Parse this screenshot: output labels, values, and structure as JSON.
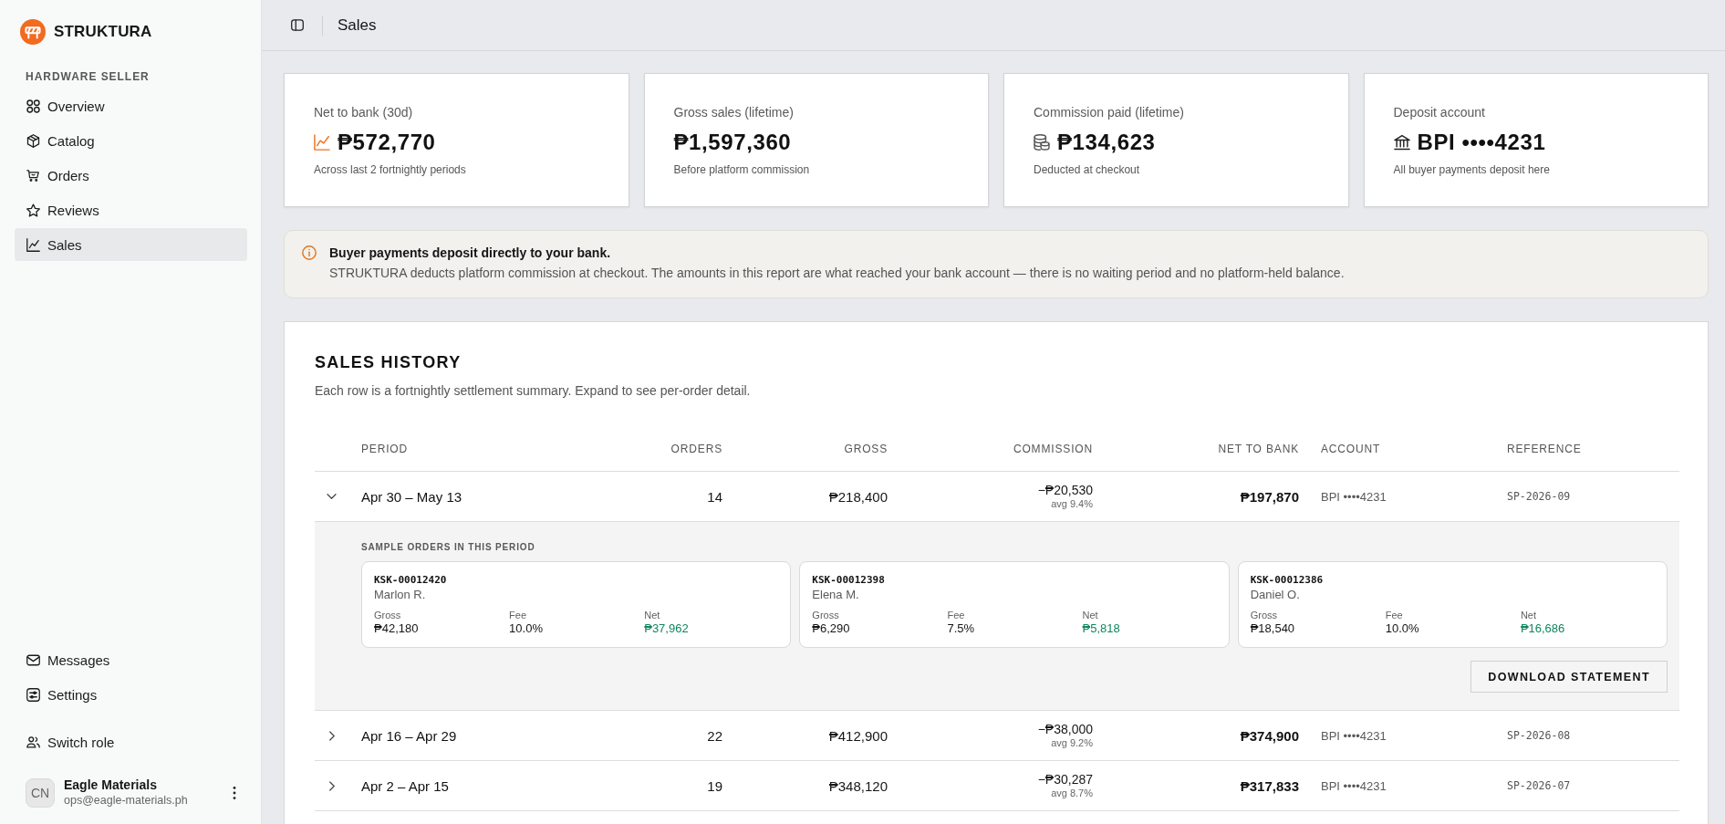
{
  "sidebar": {
    "brand": "STRUKTURA",
    "section": "HARDWARE SELLER",
    "nav": [
      {
        "label": "Overview",
        "selected": false
      },
      {
        "label": "Catalog",
        "selected": false
      },
      {
        "label": "Orders",
        "selected": false
      },
      {
        "label": "Reviews",
        "selected": false
      },
      {
        "label": "Sales",
        "selected": true
      }
    ],
    "bottom_nav": [
      {
        "label": "Messages",
        "selected": false
      },
      {
        "label": "Settings",
        "selected": false
      }
    ],
    "switch_role": "Switch role",
    "user": {
      "initials": "CN",
      "name": "Eagle Materials",
      "email": "ops@eagle-materials.ph"
    }
  },
  "topbar": {
    "title": "Sales"
  },
  "stats": [
    {
      "label": "Net to bank (30d)",
      "value": "₱572,770",
      "note": "Across last 2 fortnightly periods"
    },
    {
      "label": "Gross sales (lifetime)",
      "value": "₱1,597,360",
      "note": "Before platform commission"
    },
    {
      "label": "Commission paid (lifetime)",
      "value": "₱134,623",
      "note": "Deducted at checkout"
    },
    {
      "label": "Deposit account",
      "value": "BPI ••••4231",
      "note": "All buyer payments deposit here"
    }
  ],
  "notice": {
    "title": "Buyer payments deposit directly to your bank.",
    "text": "STRUKTURA deducts platform commission at checkout. The amounts in this report are what reached your bank account — there is no waiting period and no platform-held balance."
  },
  "sales_history": {
    "title": "SALES HISTORY",
    "subtitle": "Each row is a fortnightly settlement summary. Expand to see per-order detail.",
    "columns": [
      "PERIOD",
      "ORDERS",
      "GROSS",
      "COMMISSION",
      "NET TO BANK",
      "ACCOUNT",
      "REFERENCE"
    ],
    "rows": [
      {
        "expanded": true,
        "period": "Apr 30 – May 13",
        "orders": "14",
        "gross": "₱218,400",
        "commission": "−₱20,530",
        "commission_rate": "avg 9.4%",
        "net": "₱197,870",
        "account": "BPI ••••4231",
        "reference": "SP-2026-09",
        "detail": {
          "heading": "SAMPLE ORDERS IN THIS PERIOD",
          "orders": [
            {
              "id": "KSK-00012420",
              "buyer": "Marlon R.",
              "fields": [
                {
                  "label": "Gross",
                  "value": "₱42,180"
                },
                {
                  "label": "Fee",
                  "value": "10.0%"
                },
                {
                  "label": "Net",
                  "value": "₱37,962"
                }
              ]
            },
            {
              "id": "KSK-00012398",
              "buyer": "Elena M.",
              "fields": [
                {
                  "label": "Gross",
                  "value": "₱6,290"
                },
                {
                  "label": "Fee",
                  "value": "7.5%"
                },
                {
                  "label": "Net",
                  "value": "₱5,818"
                }
              ]
            },
            {
              "id": "KSK-00012386",
              "buyer": "Daniel O.",
              "fields": [
                {
                  "label": "Gross",
                  "value": "₱18,540"
                },
                {
                  "label": "Fee",
                  "value": "10.0%"
                },
                {
                  "label": "Net",
                  "value": "₱16,686"
                }
              ]
            }
          ],
          "button": "DOWNLOAD STATEMENT"
        }
      },
      {
        "expanded": false,
        "period": "Apr 16 – Apr 29",
        "orders": "22",
        "gross": "₱412,900",
        "commission": "−₱38,000",
        "commission_rate": "avg 9.2%",
        "net": "₱374,900",
        "account": "BPI ••••4231",
        "reference": "SP-2026-08"
      },
      {
        "expanded": false,
        "period": "Apr 2 – Apr 15",
        "orders": "19",
        "gross": "₱348,120",
        "commission": "−₱30,287",
        "commission_rate": "avg 8.7%",
        "net": "₱317,833",
        "account": "BPI ••••4231",
        "reference": "SP-2026-07"
      }
    ]
  }
}
